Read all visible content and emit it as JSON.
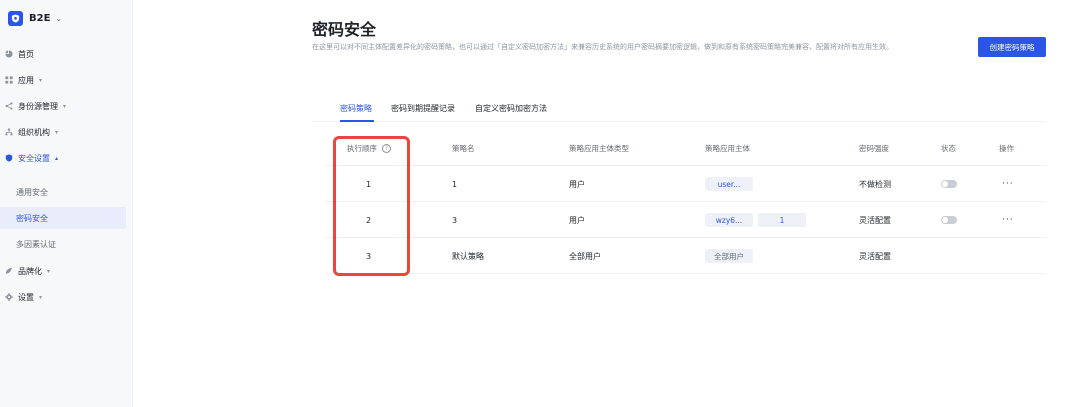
{
  "sidebar": {
    "brand": "B2E",
    "items": [
      {
        "label": "首页",
        "icon": "pie-chart-icon"
      },
      {
        "label": "应用",
        "icon": "apps-grid-icon"
      },
      {
        "label": "身份源管理",
        "icon": "share-icon"
      },
      {
        "label": "组织机构",
        "icon": "org-icon"
      },
      {
        "label": "安全设置",
        "icon": "shield-icon"
      },
      {
        "label": "品牌化",
        "icon": "palette-icon"
      },
      {
        "label": "设置",
        "icon": "gear-icon"
      }
    ],
    "security_sub": [
      "通用安全",
      "密码安全",
      "多因素认证"
    ]
  },
  "page": {
    "title": "密码安全",
    "description": "在这里可以对不同主体配置差异化的密码策略，也可以通过「自定义密码加密方法」来兼容历史系统的用户密码摘要加密逻辑，做到和原有系统密码策略完美兼容，配置将对所有应用生效。",
    "create_button": "创建密码策略"
  },
  "tabs": [
    "密码策略",
    "密码到期提醒记录",
    "自定义密码加密方法"
  ],
  "table": {
    "columns": [
      "执行顺序",
      "策略名",
      "策略应用主体类型",
      "策略应用主体",
      "密码强度",
      "状态",
      "操作"
    ],
    "rows": [
      {
        "order": "1",
        "name": "1",
        "subject_type": "用户",
        "subjects": [
          "user..."
        ],
        "strength": "不做检测",
        "status": "off",
        "action": "···"
      },
      {
        "order": "2",
        "name": "3",
        "subject_type": "用户",
        "subjects": [
          "wzy6...",
          "1"
        ],
        "strength": "灵活配置",
        "status": "off",
        "action": "···"
      },
      {
        "order": "3",
        "name": "默认策略",
        "subject_type": "全部用户",
        "subjects": [
          "全部用户"
        ],
        "strength": "灵活配置",
        "status": "",
        "action": ""
      }
    ]
  },
  "colors": {
    "accent": "#2b55e6",
    "highlight": "#e8463f"
  }
}
